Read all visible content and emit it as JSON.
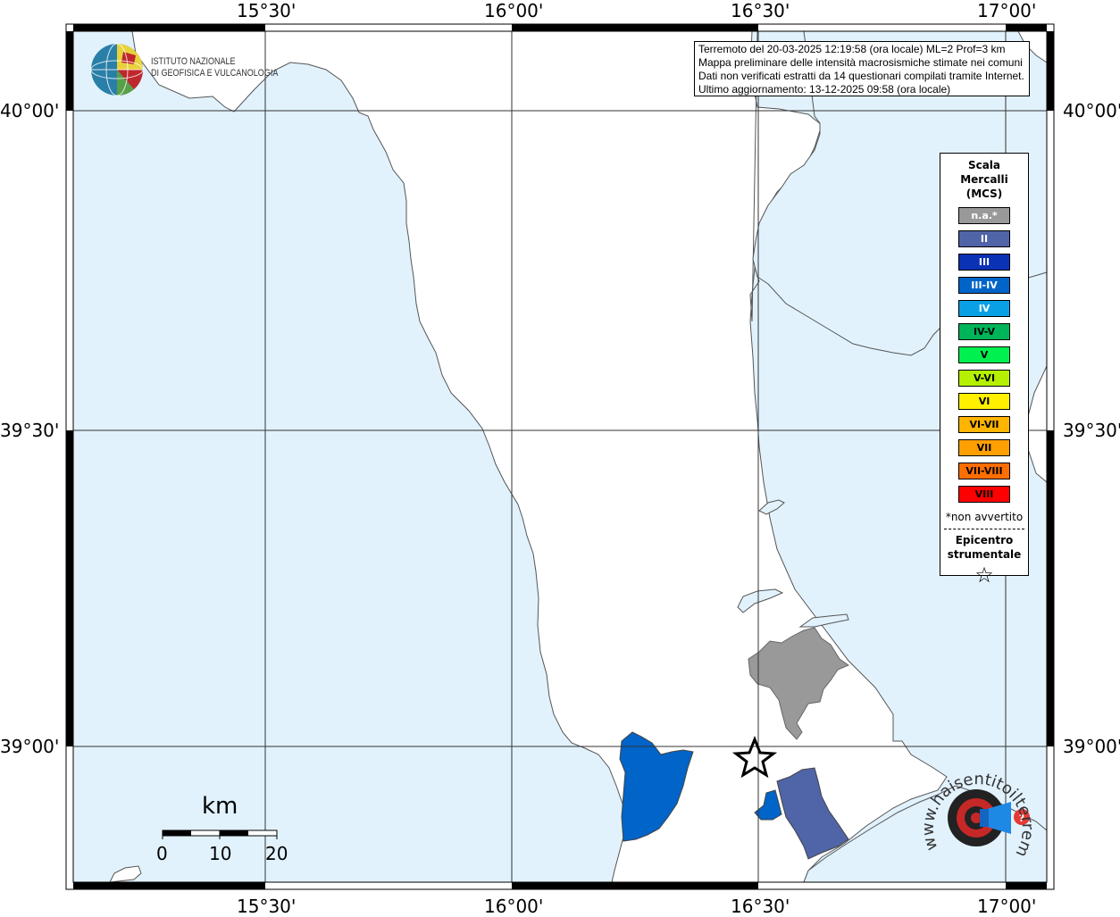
{
  "map": {
    "lon_labels": [
      "15°30'",
      "16°00'",
      "16°30'",
      "17°00'"
    ],
    "lat_labels": [
      "40°00'",
      "39°30'",
      "39°00'"
    ],
    "colors": {
      "sea": "#e1f2fd",
      "land": "#ffffff",
      "coast": "#555555"
    }
  },
  "header": {
    "institute_line1": "ISTITUTO NAZIONALE",
    "institute_line2": "DI GEOFISICA E VULCANOLOGIA"
  },
  "info": {
    "line1": "Terremoto del 20-03-2025 12:19:58 (ora locale) ML=2 Prof=3 km",
    "line2": "Mappa preliminare delle intensità macrosismiche stimate nei comuni",
    "line3": "Dati non verificati estratti da 14 questionari compilati tramite Internet.",
    "line4": "Ultimo aggiornamento: 13-12-2025 09:58 (ora locale)"
  },
  "legend": {
    "title_line1": "Scala",
    "title_line2": "Mercalli",
    "title_line3": "(MCS)",
    "items": [
      {
        "label": "n.a.*",
        "color": "#999999",
        "text": "#ffffff"
      },
      {
        "label": "II",
        "color": "#5064a8",
        "text": "#ffffff"
      },
      {
        "label": "III",
        "color": "#0a32b4",
        "text": "#ffffff"
      },
      {
        "label": "III-IV",
        "color": "#0064c8",
        "text": "#ffffff"
      },
      {
        "label": "IV",
        "color": "#0aa0e6",
        "text": "#ffffff"
      },
      {
        "label": "IV-V",
        "color": "#00b45a",
        "text": "#000000"
      },
      {
        "label": "V",
        "color": "#00f050",
        "text": "#000000"
      },
      {
        "label": "V-VI",
        "color": "#b4f000",
        "text": "#000000"
      },
      {
        "label": "VI",
        "color": "#fff000",
        "text": "#000000"
      },
      {
        "label": "VI-VII",
        "color": "#ffb400",
        "text": "#000000"
      },
      {
        "label": "VII",
        "color": "#ffa000",
        "text": "#000000"
      },
      {
        "label": "VII-VIII",
        "color": "#ff6e00",
        "text": "#000000"
      },
      {
        "label": "VIII",
        "color": "#ff0000",
        "text": "#000000"
      }
    ],
    "note": "*non avvertito",
    "epicenter_line1": "Epicentro",
    "epicenter_line2": "strumentale",
    "epicenter_symbol": "☆"
  },
  "scalebar": {
    "unit": "km",
    "ticks": [
      "0",
      "10",
      "20"
    ]
  },
  "municipalities": [
    {
      "intensity": "n.a.*",
      "color": "#999999"
    },
    {
      "intensity": "III-IV",
      "color": "#0064c8"
    },
    {
      "intensity": "II",
      "color": "#5064a8"
    }
  ],
  "epicenter": {
    "lon": "16°30'",
    "lat": "38°59'"
  },
  "watermark": {
    "text": "www.haisentitoilterremoto.it",
    "colors": {
      "dark": "#333333",
      "accent": "#e53935",
      "blue": "#1e88e5"
    }
  }
}
